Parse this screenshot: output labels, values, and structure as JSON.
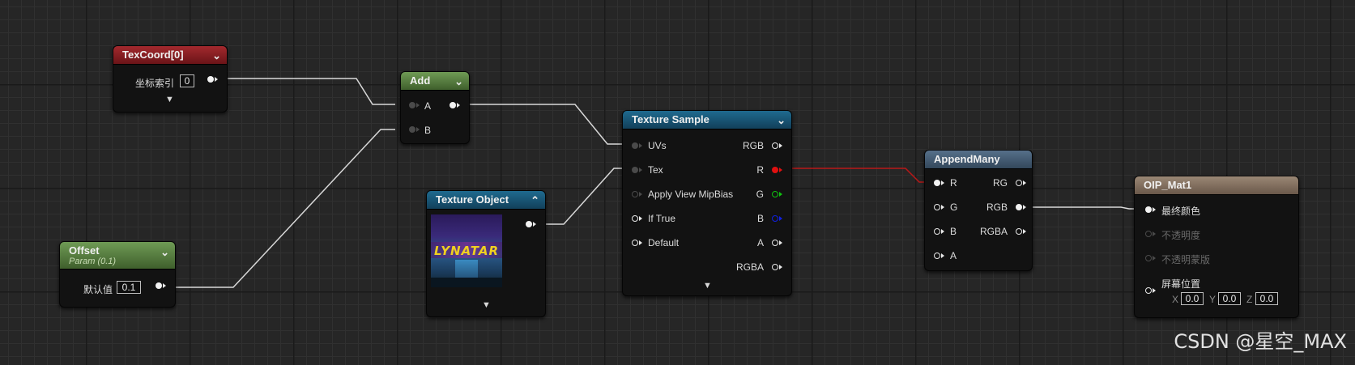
{
  "nodes": {
    "texcoord": {
      "title": "TexCoord[0]",
      "index_label": "坐标索引",
      "index_value": "0"
    },
    "add": {
      "title": "Add",
      "pin_a": "A",
      "pin_b": "B"
    },
    "offset": {
      "title": "Offset",
      "subtitle": "Param (0.1)",
      "default_label": "默认值",
      "default_value": "0.1"
    },
    "texture_object": {
      "title": "Texture Object",
      "thumbnail_text": "LYNATAR"
    },
    "texture_sample": {
      "title": "Texture Sample",
      "inputs": [
        "UVs",
        "Tex",
        "Apply View MipBias",
        "If True",
        "Default"
      ],
      "outputs": [
        "RGB",
        "R",
        "G",
        "B",
        "A",
        "RGBA"
      ]
    },
    "append_many": {
      "title": "AppendMany",
      "inputs": [
        "R",
        "G",
        "B",
        "A"
      ],
      "outputs": [
        "RG",
        "RGB",
        "RGBA"
      ]
    },
    "material": {
      "title": "OIP_Mat1",
      "pins": [
        "最终颜色",
        "不透明度",
        "不透明蒙版",
        "屏幕位置"
      ],
      "screen_x_label": "X",
      "screen_x": "0.0",
      "screen_y_label": "Y",
      "screen_y": "0.0",
      "screen_z_label": "Z",
      "screen_z": "0.0"
    }
  },
  "watermark": "CSDN @星空_MAX",
  "colors": {
    "wire_white": "#d8d8d8",
    "wire_red": "#b81818",
    "header_red": "#a3292e",
    "header_green": "#6f9b55",
    "header_blue": "#1f6a8f",
    "header_steel": "#56708a",
    "header_brown": "#9a8775",
    "pin_green": "#10c010",
    "pin_blue": "#1020e0"
  },
  "icons": [
    "chevron-down-icon",
    "chevron-up-icon",
    "pin-icon"
  ]
}
